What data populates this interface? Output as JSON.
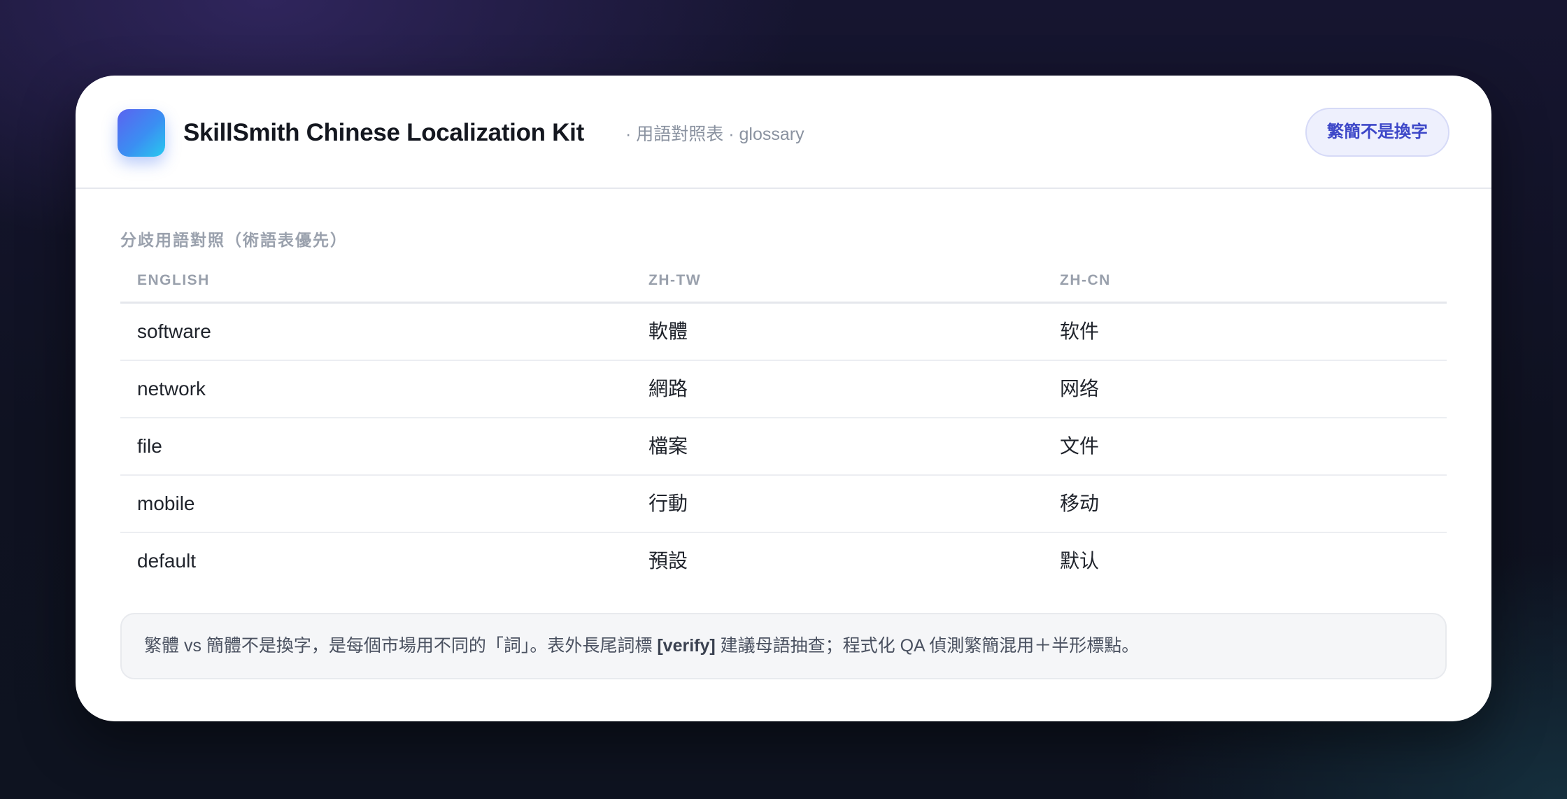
{
  "header": {
    "title": "SkillSmith Chinese Localization Kit",
    "subtitle": "· 用語對照表 · glossary",
    "badge_label": "繁簡不是換字"
  },
  "section": {
    "title": "分歧用語對照（術語表優先）"
  },
  "table": {
    "columns": [
      "ENGLISH",
      "ZH-TW",
      "ZH-CN"
    ],
    "rows": [
      {
        "en": "software",
        "tw": "軟體",
        "cn": "软件"
      },
      {
        "en": "network",
        "tw": "網路",
        "cn": "网络"
      },
      {
        "en": "file",
        "tw": "檔案",
        "cn": "文件"
      },
      {
        "en": "mobile",
        "tw": "行動",
        "cn": "移动"
      },
      {
        "en": "default",
        "tw": "預設",
        "cn": "默认"
      }
    ]
  },
  "note": {
    "text_before": "繁體 vs 簡體不是換字，是每個市場用不同的「詞」。表外長尾詞標 ",
    "tag": "[verify]",
    "text_after": " 建議母語抽查；程式化 QA 偵測繁簡混用＋半形標點。"
  },
  "colors": {
    "accent": "#3d47c8",
    "icon_gradient_start": "#5b63f0",
    "icon_gradient_end": "#27c9ef"
  }
}
